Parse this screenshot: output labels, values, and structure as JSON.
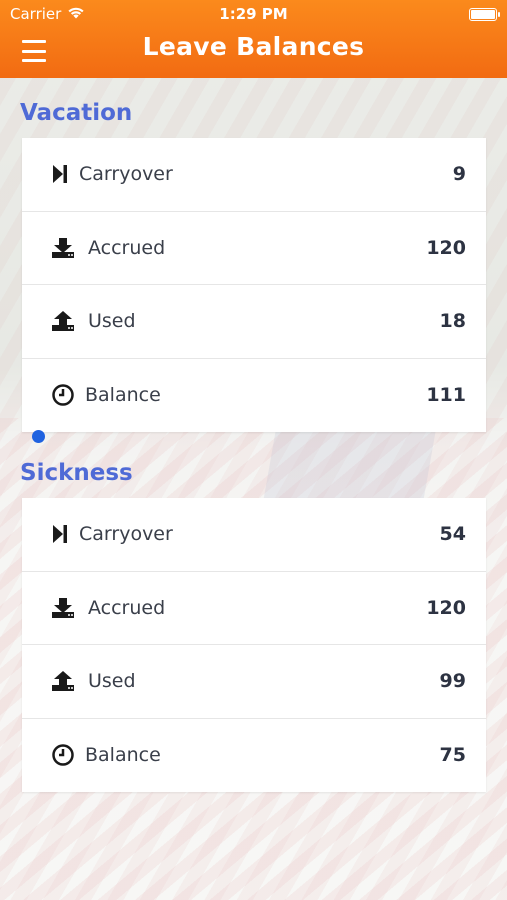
{
  "status": {
    "carrier": "Carrier",
    "time": "1:29 PM"
  },
  "header": {
    "title": "Leave Balances"
  },
  "vacation": {
    "title": "Vacation",
    "rows": [
      {
        "icon": "skip-forward-icon",
        "label": "Carryover",
        "value": "9"
      },
      {
        "icon": "download-icon",
        "label": "Accrued",
        "value": "120"
      },
      {
        "icon": "upload-icon",
        "label": "Used",
        "value": "18"
      },
      {
        "icon": "clock-icon",
        "label": "Balance",
        "value": "111"
      }
    ]
  },
  "sickness": {
    "title": "Sickness",
    "rows": [
      {
        "icon": "skip-forward-icon",
        "label": "Carryover",
        "value": "54"
      },
      {
        "icon": "download-icon",
        "label": "Accrued",
        "value": "120"
      },
      {
        "icon": "upload-icon",
        "label": "Used",
        "value": "99"
      },
      {
        "icon": "clock-icon",
        "label": "Balance",
        "value": "75"
      }
    ]
  },
  "colors": {
    "header_start": "#fb8a1c",
    "header_end": "#f26b12",
    "section_title": "#4f6ad6",
    "page_indicator": "#1f62e0"
  }
}
